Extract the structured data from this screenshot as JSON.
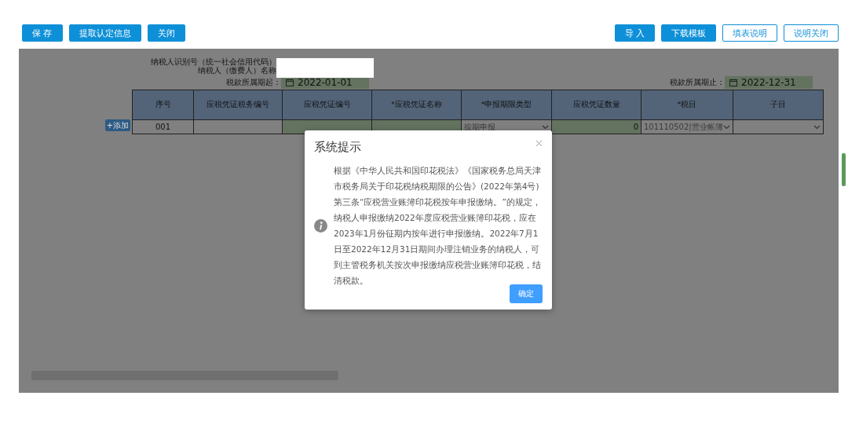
{
  "toolbar": {
    "left_buttons": [
      {
        "label": "保 存",
        "kind": "primary"
      },
      {
        "label": "提取认定信息",
        "kind": "primary"
      },
      {
        "label": "关闭",
        "kind": "primary"
      }
    ],
    "right_buttons": [
      {
        "label": "导 入",
        "kind": "primary"
      },
      {
        "label": "下载模板",
        "kind": "primary"
      },
      {
        "label": "填表说明",
        "kind": "outline"
      },
      {
        "label": "说明关闭",
        "kind": "outline"
      }
    ]
  },
  "form": {
    "taxpayer_id_label": "纳税人识别号（统一社会信用代码）",
    "taxpayer_name_label": "纳税人（缴费人）名称",
    "period_start": {
      "label": "税款所属期起：",
      "value": "2022-01-01"
    },
    "period_end": {
      "label": "税款所属期止：",
      "value": "2022-12-31"
    }
  },
  "table": {
    "add_button": "+添加",
    "columns": [
      "序号",
      "应税凭证税务编号",
      "应税凭证编号",
      "*应税凭证名称",
      "*申报期限类型",
      "应税凭证数量",
      "*税目",
      "子目"
    ],
    "rows": [
      {
        "cells": [
          {
            "kind": "plain",
            "text": "001"
          },
          {
            "kind": "plain"
          },
          {
            "kind": "input"
          },
          {
            "kind": "input"
          },
          {
            "kind": "select",
            "text": "按期申报"
          },
          {
            "kind": "number",
            "text": "0"
          },
          {
            "kind": "select",
            "text": "101110502|营业帐簿"
          },
          {
            "kind": "select"
          }
        ]
      }
    ]
  },
  "dialog": {
    "title": "系统提示",
    "message": "根据《中华人民共和国印花税法》《国家税务总局天津市税务局关于印花税纳税期限的公告》(2022年第4号)第三条“应税营业账簿印花税按年申报缴纳。”的规定，纳税人申报缴纳2022年度应税营业账簿印花税，应在2023年1月份征期内按年进行申报缴纳。2022年7月1日至2022年12月31日期间办理注销业务的纳税人，可到主管税务机关按次申报缴纳应税营业账簿印花税，结清税款。",
    "confirm": "确定"
  }
}
